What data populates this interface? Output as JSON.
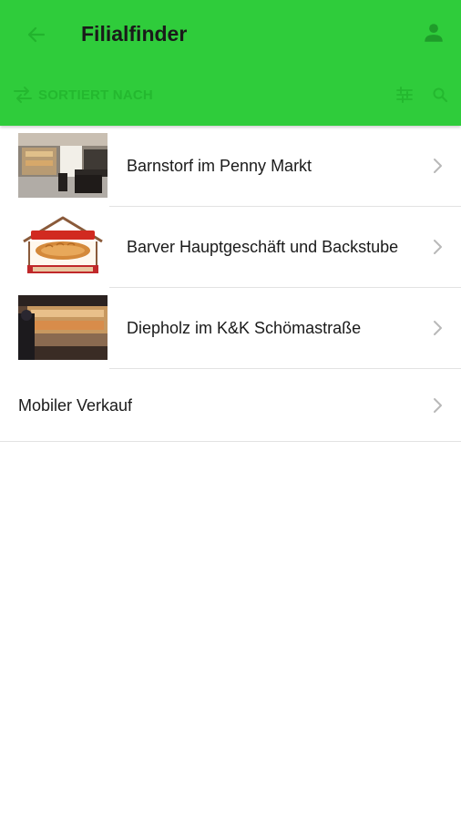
{
  "header": {
    "title": "Filialfinder",
    "sort_label": "SORTIERT NACH",
    "background_color": "#2fcc3b",
    "accent_color": "#24b82f"
  },
  "icons": {
    "back": "arrow-left-icon",
    "profile": "person-icon",
    "sort": "swap-arrows-icon",
    "filter": "filter-sliders-icon",
    "search": "search-icon",
    "chevron": "chevron-right-icon"
  },
  "stores": [
    {
      "name": "Barnstorf im Penny Markt",
      "thumbnail": "store-interior-photo"
    },
    {
      "name": "Barver Hauptgeschäft und Backstube",
      "thumbnail": "bakery-logo"
    },
    {
      "name": "Diepholz im K&K Schömastraße",
      "thumbnail": "bakery-counter-photo"
    },
    {
      "name": "Mobiler Verkauf"
    }
  ]
}
